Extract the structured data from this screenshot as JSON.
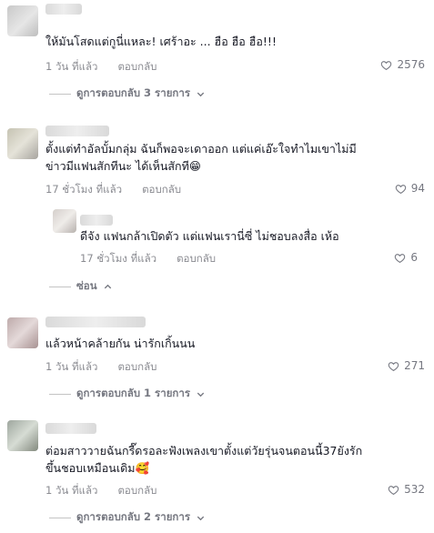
{
  "comments": [
    {
      "text": "ให้มันโสดแต่กูนี่แหละ! เศร้าอะ ... ฮือ ฮือ ฮือ!!!",
      "time": "1 วัน ที่แล้ว",
      "reply_label": "ตอบกลับ",
      "likes": "2576",
      "view_replies": "ดูการตอบกลับ 3 รายการ"
    },
    {
      "text": "ตั้งแต่ทำอัลบั้มกลุ่ม ฉันก็พอจะเดาออก แต่แค่เอ๊ะใจทำไมเขาไม่มี\nข่าวมีแฟนสักทีนะ ได้เห็นสักที😁",
      "time": "17 ชั่วโมง ที่แล้ว",
      "reply_label": "ตอบกลับ",
      "likes": "94",
      "reply": {
        "text": "ดีจัง แฟนกล้าเปิดตัว แต่แฟนเรานี่ซี่ ไม่ชอบลงสื่อ เห้อ",
        "time": "17 ชั่วโมง ที่แล้ว",
        "reply_label": "ตอบกลับ",
        "likes": "6"
      },
      "hide_label": "ซ่อน"
    },
    {
      "text": "แล้วหน้าคล้ายกัน น่ารักเกิ้นนน",
      "time": "1 วัน ที่แล้ว",
      "reply_label": "ตอบกลับ",
      "likes": "271",
      "view_replies": "ดูการตอบกลับ 1 รายการ"
    },
    {
      "text": "ต่อมสาววายฉันกรี๊ดรอละฟังเพลงเขาตั้งแต่วัยรุ่นจนตอนนี้37ยังรัก\nขึ้นชอบเหมือนเดิม🥰",
      "time": "1 วัน ที่แล้ว",
      "reply_label": "ตอบกลับ",
      "likes": "532",
      "view_replies": "ดูการตอบกลับ 2 รายการ"
    }
  ]
}
